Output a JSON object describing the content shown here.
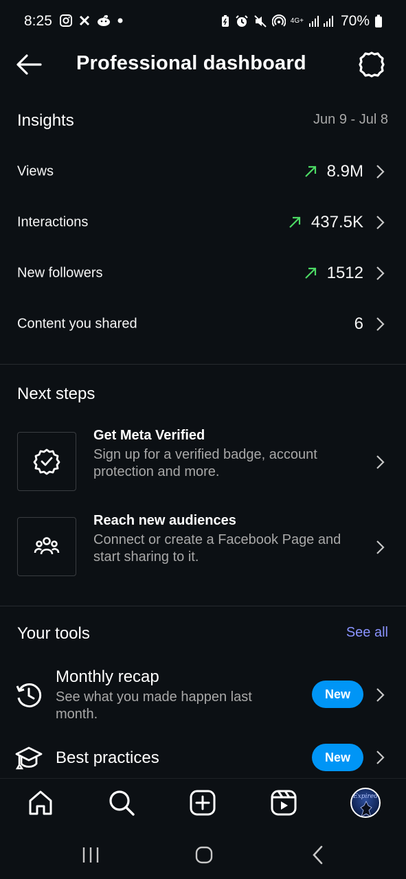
{
  "status_bar": {
    "time": "8:25",
    "battery": "70%",
    "network": "4G+",
    "icons": [
      "instagram-icon",
      "x-app-icon",
      "reddit-icon",
      "dot-icon",
      "battery-saver-icon",
      "alarm-icon",
      "mute-icon",
      "hotspot-icon",
      "signal-icon",
      "battery-icon"
    ]
  },
  "header": {
    "title": "Professional dashboard",
    "back_icon": "back-arrow-icon",
    "settings_icon": "settings-icon"
  },
  "insights": {
    "title": "Insights",
    "date_range": "Jun 9 - Jul 8",
    "rows": [
      {
        "label": "Views",
        "value": "8.9M",
        "trend": "up"
      },
      {
        "label": "Interactions",
        "value": "437.5K",
        "trend": "up"
      },
      {
        "label": "New followers",
        "value": "1512",
        "trend": "up"
      },
      {
        "label": "Content you shared",
        "value": "6",
        "trend": "none"
      }
    ],
    "trend_color": "#4cd964"
  },
  "next_steps": {
    "title": "Next steps",
    "items": [
      {
        "title": "Get Meta Verified",
        "desc": "Sign up for a verified badge, account protection and more.",
        "icon": "verified-badge-icon"
      },
      {
        "title": "Reach new audiences",
        "desc": "Connect or create a Facebook Page and start sharing to it.",
        "icon": "audience-icon"
      }
    ]
  },
  "tools": {
    "title": "Your tools",
    "see_all": "See all",
    "items": [
      {
        "title": "Monthly recap",
        "desc": "See what you made happen last month.",
        "badge": "New",
        "icon": "history-icon"
      },
      {
        "title": "Best practices",
        "desc": "",
        "badge": "New",
        "icon": "graduation-cap-icon"
      }
    ],
    "badge_color": "#0095f6",
    "link_color": "#8a93ff"
  },
  "bottom_nav": {
    "items": [
      "home-icon",
      "search-icon",
      "create-icon",
      "reels-icon",
      "profile-avatar"
    ],
    "avatar_text": "Expired"
  },
  "system_nav": {
    "items": [
      "recents-icon",
      "home-circle-icon",
      "back-chevron-icon"
    ]
  }
}
